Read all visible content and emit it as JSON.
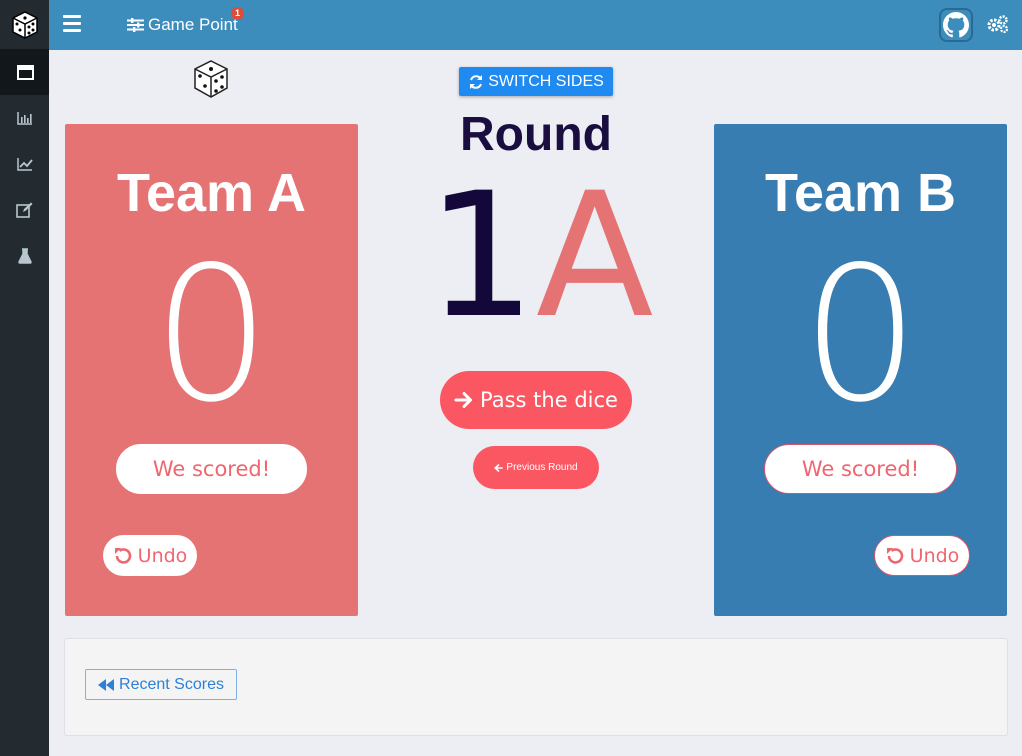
{
  "topbar": {
    "title": "Game Point",
    "notification_count": "1"
  },
  "sidebar": {
    "items": [
      {
        "icon": "window-icon",
        "active": true
      },
      {
        "icon": "bar-chart-icon",
        "active": false
      },
      {
        "icon": "line-chart-icon",
        "active": false
      },
      {
        "icon": "edit-icon",
        "active": false
      },
      {
        "icon": "flask-icon",
        "active": false
      }
    ]
  },
  "controls": {
    "switch_sides_label": "SWITCH SIDES",
    "pass_dice_label": "Pass the dice",
    "previous_round_label": "Previous Round"
  },
  "round": {
    "title": "Round",
    "number": "1",
    "side": "A"
  },
  "teams": {
    "a": {
      "name": "Team A",
      "score": "0",
      "scored_label": "We scored!",
      "undo_label": "Undo",
      "color": "#e57373"
    },
    "b": {
      "name": "Team B",
      "score": "0",
      "scored_label": "We scored!",
      "undo_label": "Undo",
      "color": "#387db2"
    }
  },
  "bottom": {
    "recent_scores_label": "Recent Scores"
  },
  "colors": {
    "topbar": "#3c8dbc",
    "sidebar": "#232b31",
    "accent_button": "#fb5763",
    "switch_button": "#1f8bf0"
  }
}
